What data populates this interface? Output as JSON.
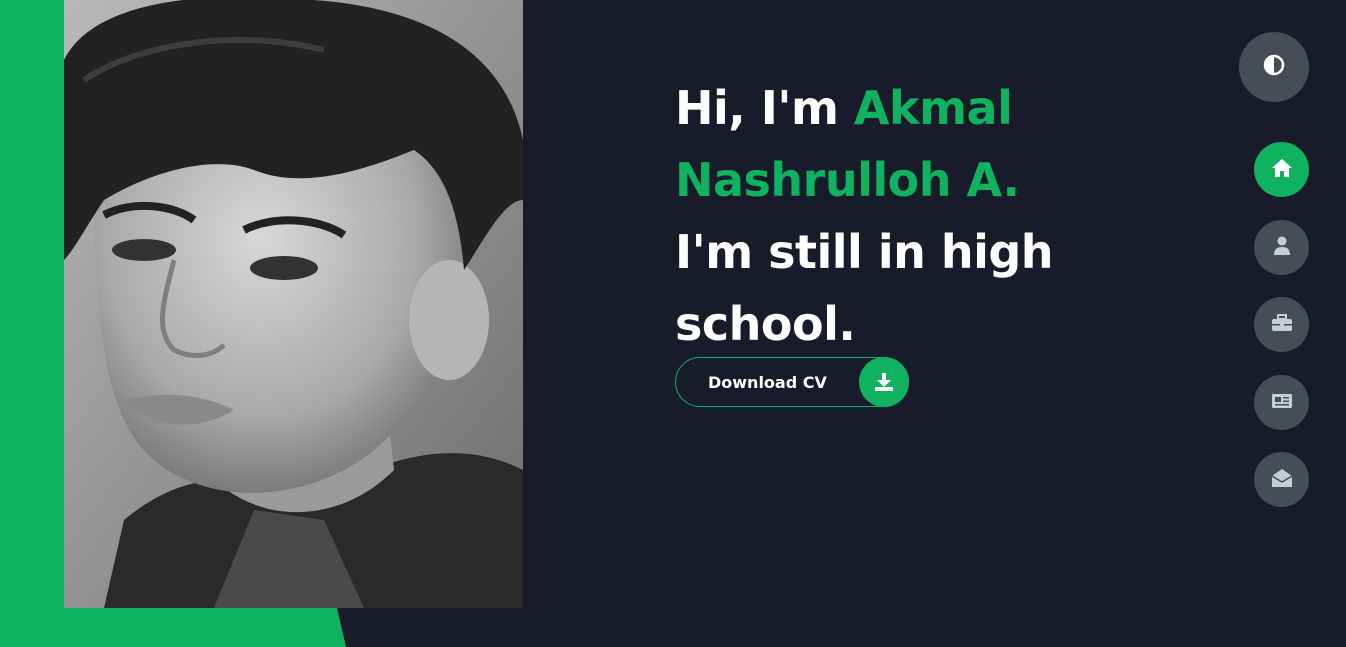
{
  "hero": {
    "greeting": "Hi, I'm",
    "name_first": "Akmal",
    "name_last": "Nashrulloh A.",
    "tagline_1": "I'm still in high",
    "tagline_2": "school."
  },
  "download_button": {
    "label": "Download CV",
    "icon": "download-icon"
  },
  "theme_toggle": {
    "icon": "half-circle-icon"
  },
  "nav": [
    {
      "name": "home",
      "icon": "home-icon",
      "active": true
    },
    {
      "name": "about",
      "icon": "user-icon",
      "active": false
    },
    {
      "name": "portfolio",
      "icon": "briefcase-icon",
      "active": false
    },
    {
      "name": "blog",
      "icon": "newspaper-icon",
      "active": false
    },
    {
      "name": "contact",
      "icon": "envelope-open-icon",
      "active": false
    }
  ],
  "colors": {
    "accent": "#0fb25f",
    "background": "#181c2a",
    "nav_button": "#454e56",
    "text": "#ffffff"
  }
}
